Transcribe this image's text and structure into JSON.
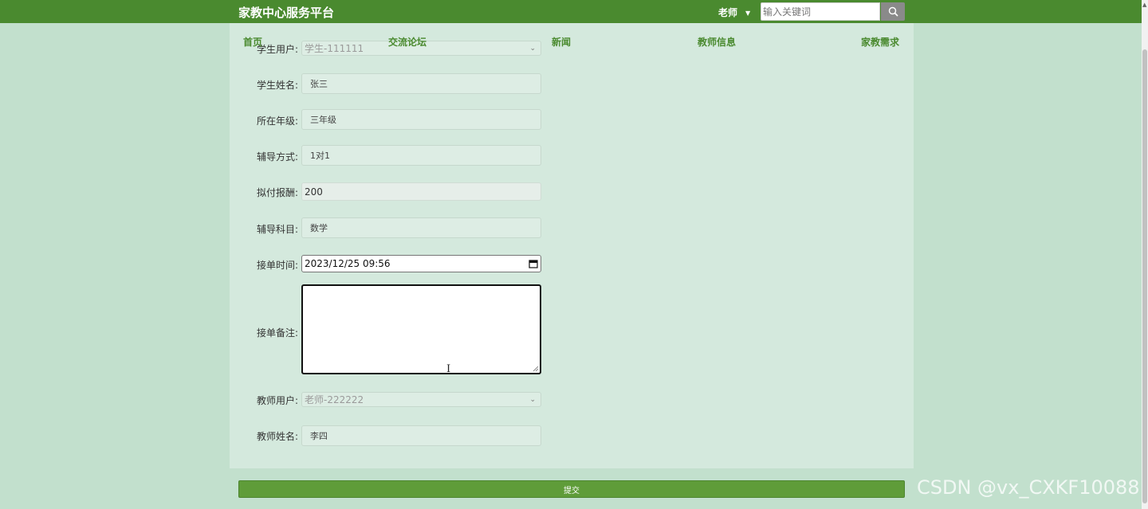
{
  "header": {
    "brand": "家教中心服务平台",
    "user_label": "老师",
    "search_placeholder": "输入关键词"
  },
  "nav": [
    {
      "label": "首页"
    },
    {
      "label": "交流论坛"
    },
    {
      "label": "新闻"
    },
    {
      "label": "教师信息"
    },
    {
      "label": "家教需求"
    }
  ],
  "form": {
    "student_user": {
      "label": "学生用户:",
      "value": "学生-111111"
    },
    "student_name": {
      "label": "学生姓名:",
      "value": "张三"
    },
    "grade": {
      "label": "所在年级:",
      "value": "三年级"
    },
    "tutoring_mode": {
      "label": "辅导方式:",
      "value": "1对1"
    },
    "pay": {
      "label": "拟付报酬:",
      "value": "200"
    },
    "subject": {
      "label": "辅导科目:",
      "value": "数学"
    },
    "order_time": {
      "label": "接单时间:",
      "value": "2023/12/25 09:56"
    },
    "order_note": {
      "label": "接单备注:",
      "value": ""
    },
    "teacher_user": {
      "label": "教师用户:",
      "value": "老师-222222"
    },
    "teacher_name": {
      "label": "教师姓名:",
      "value": "李四"
    }
  },
  "submit_label": "提交",
  "watermark": "CSDN @vx_CXKF10088",
  "colors": {
    "header_bg": "#4a8a2f",
    "page_bg": "#c2e0cd",
    "panel_bg": "#d4e9dd",
    "nav_text": "#4a8a2f",
    "submit_bg": "#5f9c39"
  }
}
